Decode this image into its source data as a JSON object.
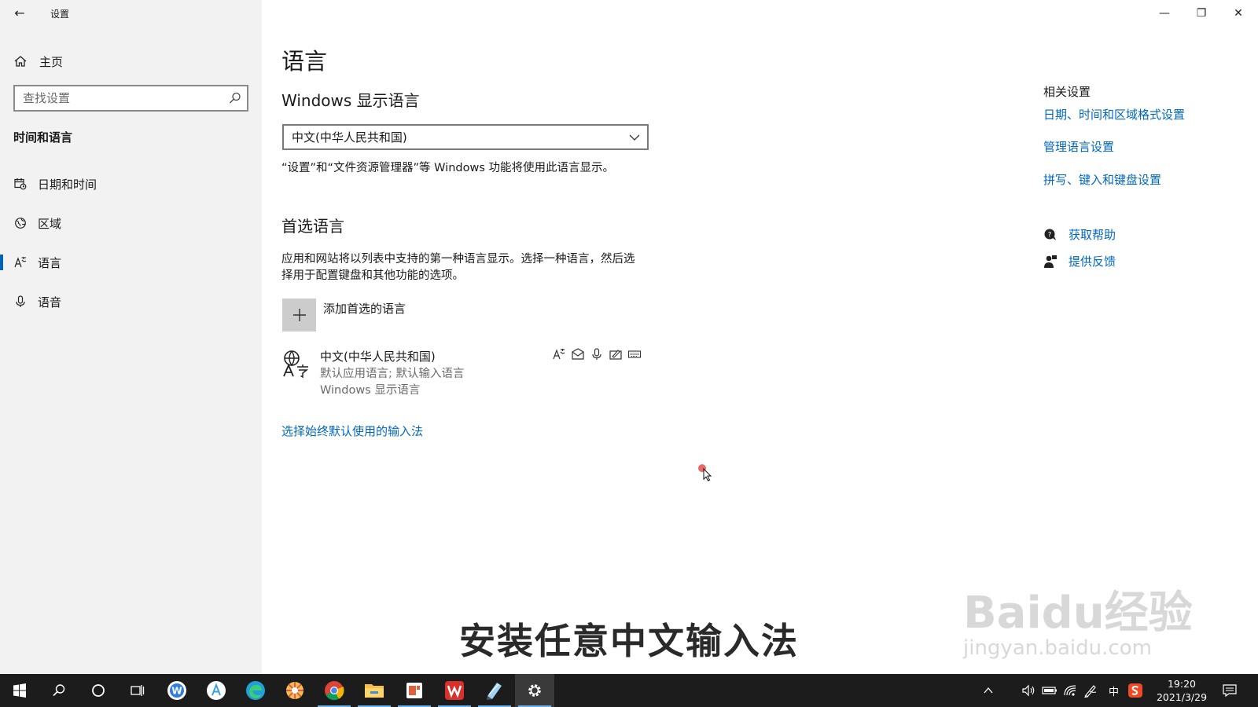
{
  "window": {
    "title": "设置",
    "minimize_glyph": "—",
    "restore_glyph": "❐",
    "close_glyph": "✕"
  },
  "sidebar": {
    "home_label": "主页",
    "search_placeholder": "查找设置",
    "section_title": "时间和语言",
    "items": [
      {
        "label": "日期和时间",
        "icon": "calendar-clock-icon"
      },
      {
        "label": "区域",
        "icon": "globe-region-icon"
      },
      {
        "label": "语言",
        "icon": "language-icon",
        "active": true
      },
      {
        "label": "语音",
        "icon": "microphone-icon"
      }
    ]
  },
  "main": {
    "page_title": "语言",
    "display_lang_heading": "Windows 显示语言",
    "display_lang_value": "中文(中华人民共和国)",
    "display_lang_note": "“设置”和“文件资源管理器”等 Windows 功能将使用此语言显示。",
    "preferred_heading": "首选语言",
    "preferred_desc": "应用和网站将以列表中支持的第一种语言显示。选择一种语言，然后选择用于配置键盘和其他功能的选项。",
    "add_label": "添加首选的语言",
    "language": {
      "name": "中文(中华人民共和国)",
      "line1": "默认应用语言; 默认输入语言",
      "line2": "Windows 显示语言",
      "features": [
        "language-pack-icon",
        "text-to-speech-icon",
        "speech-icon",
        "handwriting-icon",
        "keyboard-icon"
      ]
    },
    "ime_link": "选择始终默认使用的输入法"
  },
  "related": {
    "title": "相关设置",
    "links": [
      "日期、时间和区域格式设置",
      "管理语言设置",
      "拼写、键入和键盘设置"
    ],
    "help": "获取帮助",
    "feedback": "提供反馈"
  },
  "caption": "安装任意中文输入法",
  "watermark": {
    "main": "Baidu经验",
    "sub": "jingyan.baidu.com"
  },
  "taskbar": {
    "apps": [
      "start-icon",
      "search-icon",
      "cortana-icon",
      "task-view-icon",
      "app-w-icon",
      "app-a-icon",
      "edge-icon",
      "photos-icon",
      "chrome-icon",
      "file-explorer-icon",
      "app-red-icon",
      "wps-icon",
      "notepad-icon",
      "settings-icon"
    ],
    "ime_indicator": "中",
    "time": "19:20",
    "date": "2021/3/29"
  },
  "colors": {
    "link": "#0067c0",
    "accent": "#0063b1",
    "sidebar_bg": "#f2f2f2",
    "taskbar_bg": "#1c1c1c"
  }
}
